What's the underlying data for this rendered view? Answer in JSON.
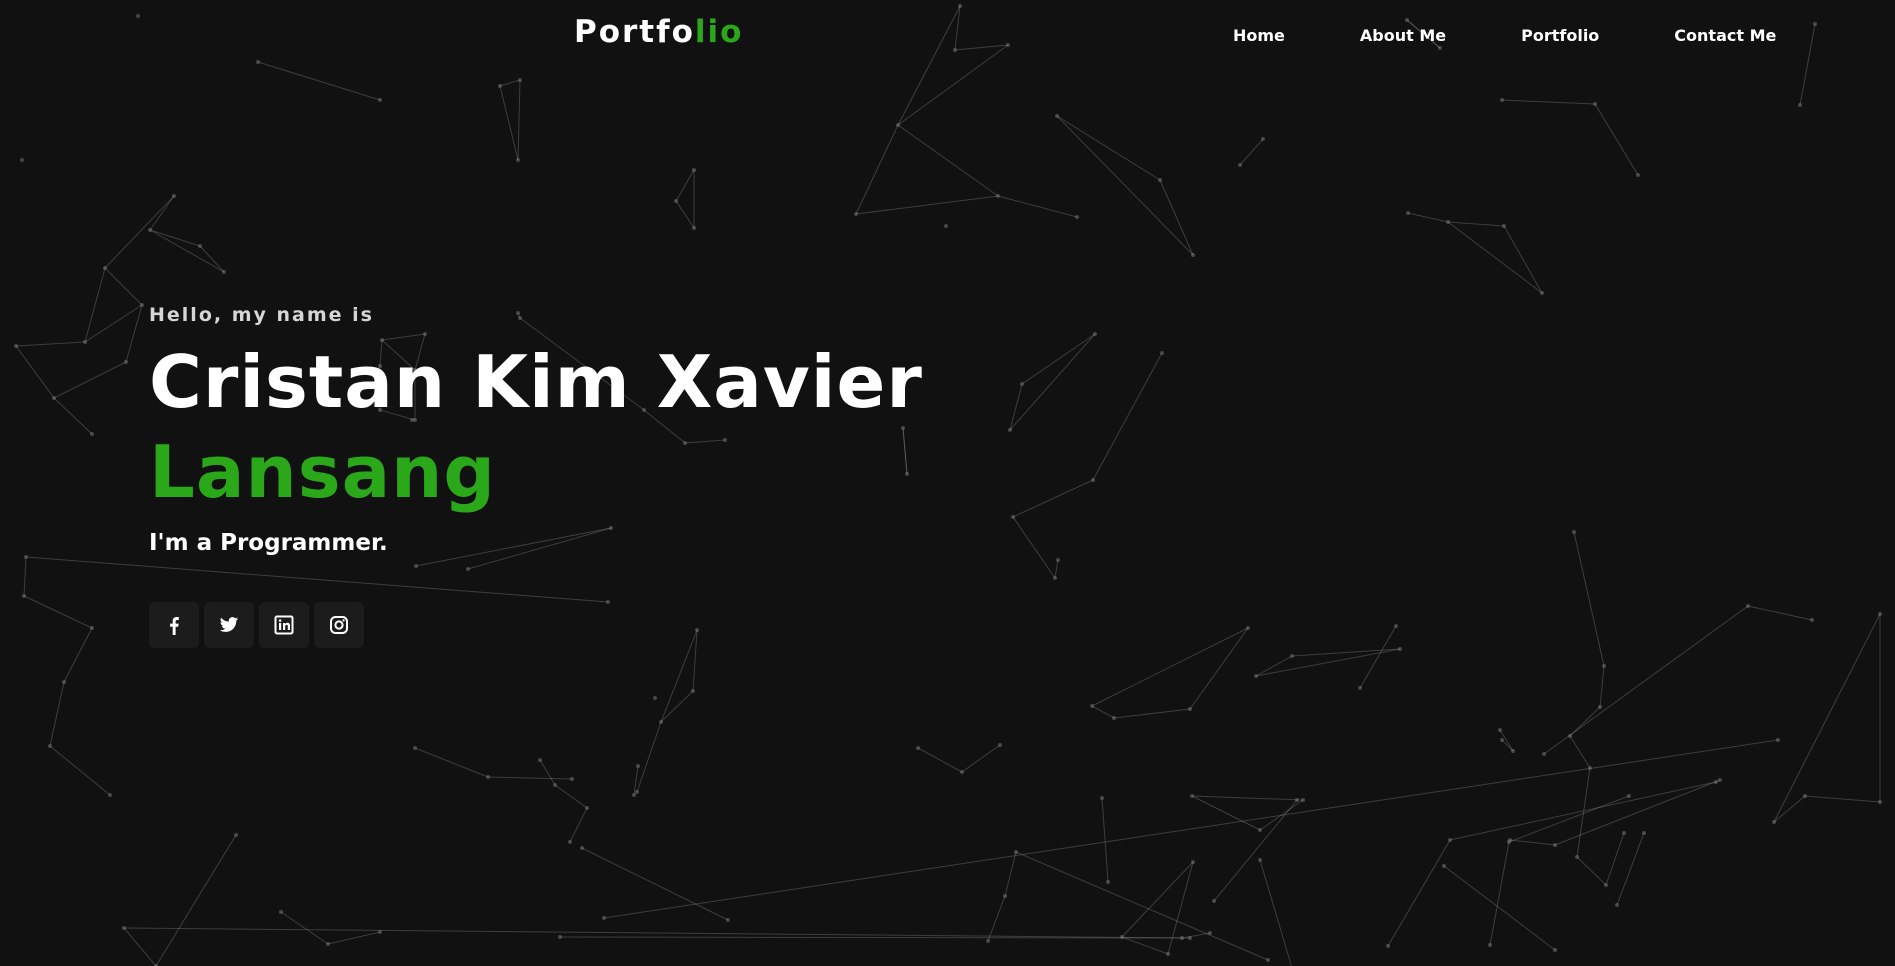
{
  "colors": {
    "background": "#111111",
    "accent": "#2aa81a",
    "text": "#ffffff",
    "muted_text": "#d6d6d6",
    "social_button_bg": "#1c1c1c",
    "particle": "#9a9a9a"
  },
  "header": {
    "brand_main": "Portfo",
    "brand_accent": "lio",
    "nav": {
      "home": "Home",
      "about": "About Me",
      "portfolio": "Portfolio",
      "contact": "Contact Me"
    }
  },
  "hero": {
    "greeting": "Hello, my name is",
    "name_first": "Cristan Kim Xavier",
    "name_last": "Lansang",
    "role": "I'm a Programmer."
  },
  "socials": [
    {
      "icon": "facebook-icon"
    },
    {
      "icon": "twitter-icon"
    },
    {
      "icon": "linkedin-icon"
    },
    {
      "icon": "instagram-icon"
    }
  ]
}
